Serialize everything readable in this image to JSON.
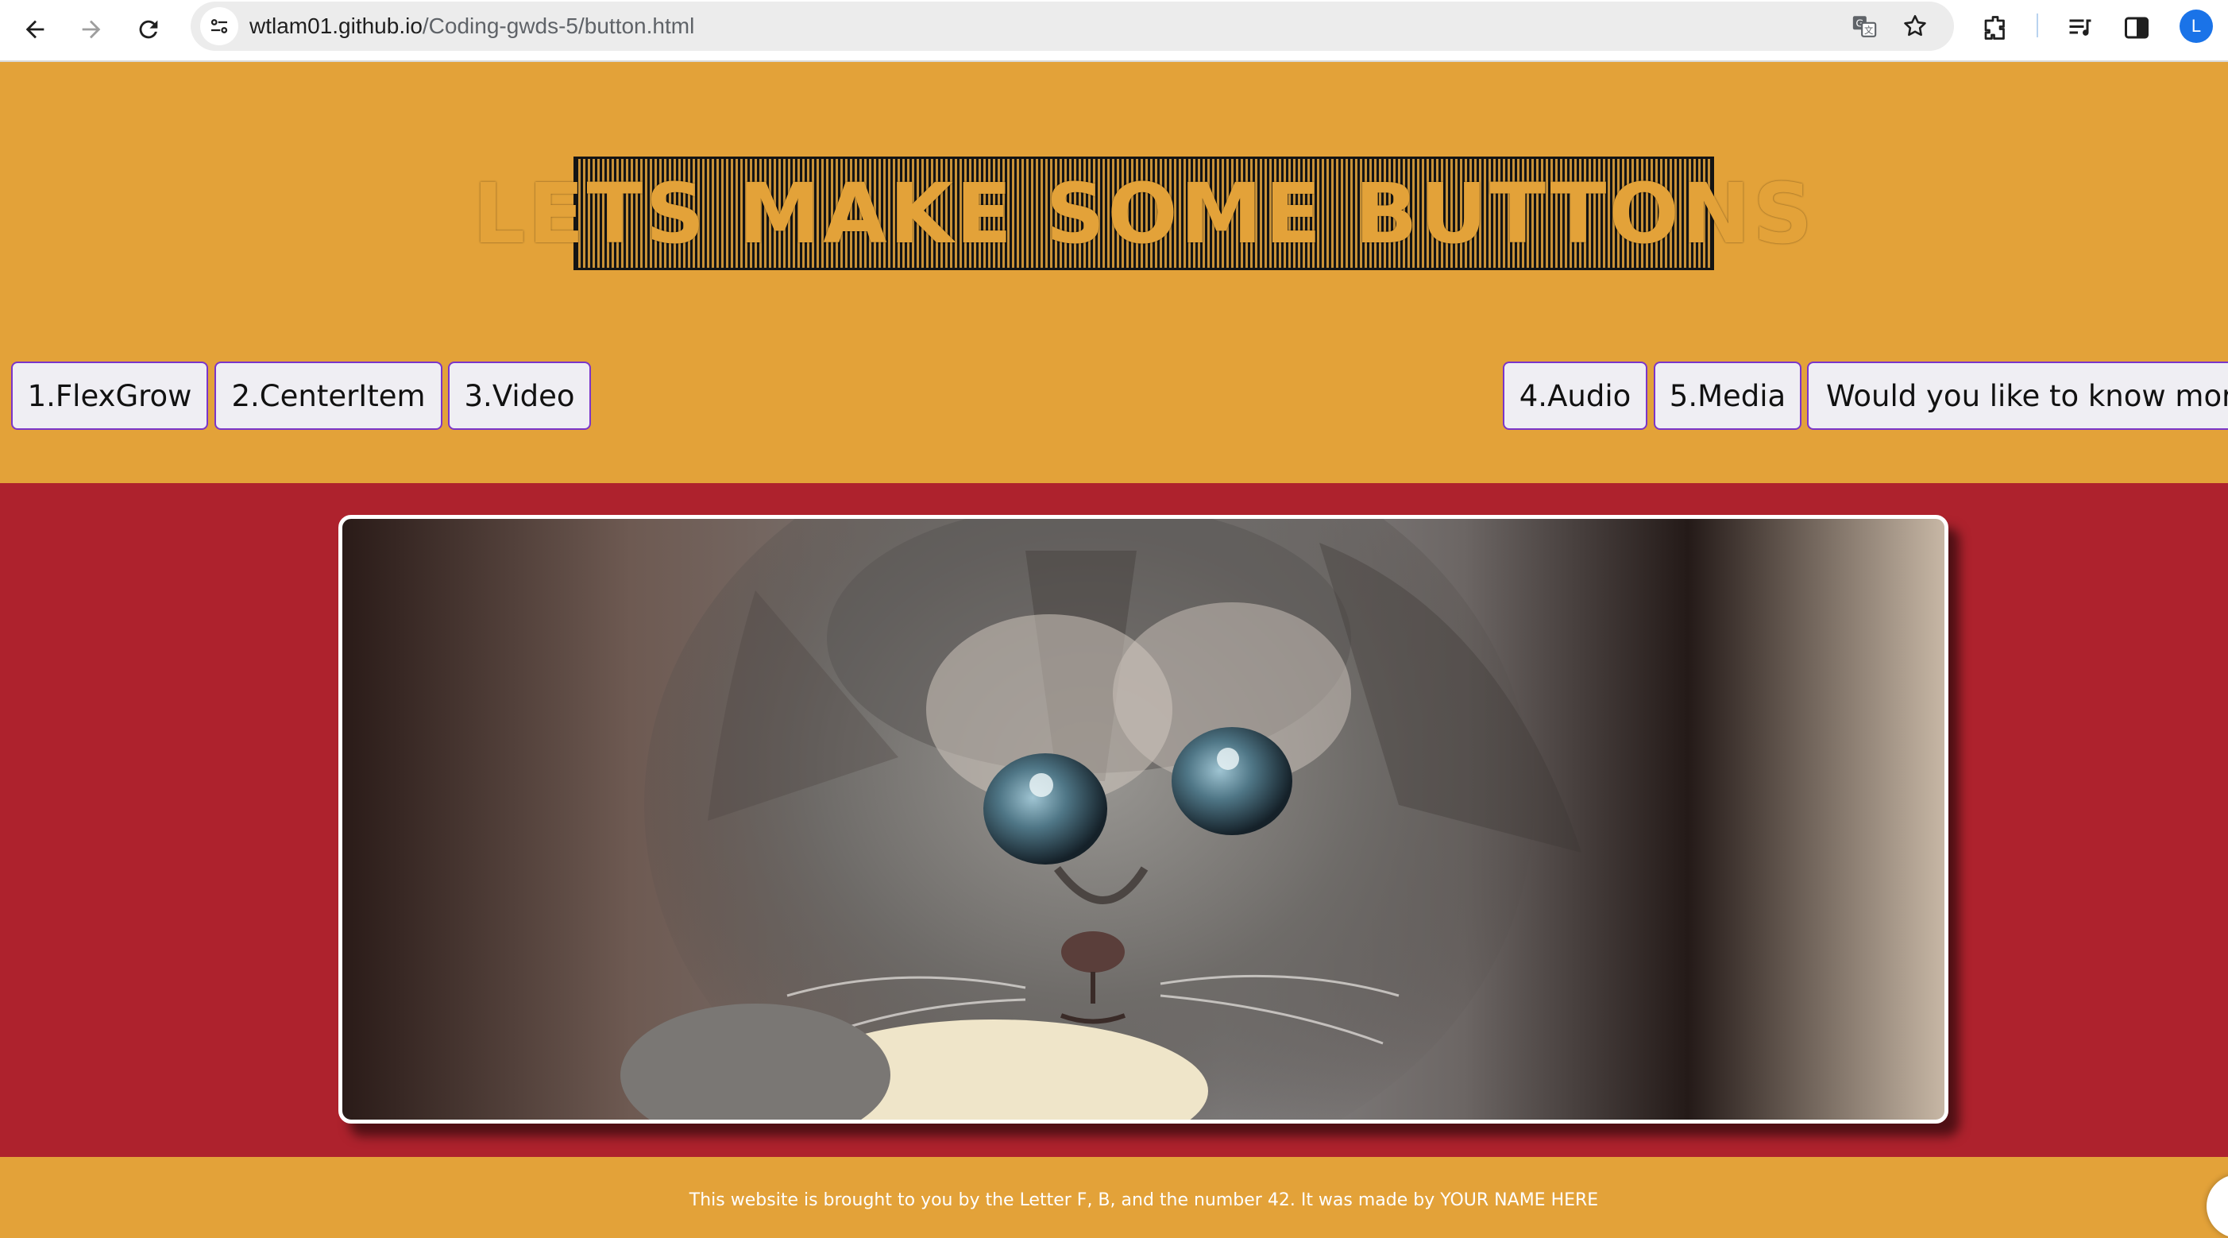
{
  "browser": {
    "url_host": "wtlam01.github.io",
    "url_path": "/Coding-gwds-5/button.html",
    "profile_initial": "L",
    "icons": [
      "back-arrow-icon",
      "forward-arrow-icon",
      "reload-icon",
      "site-settings-icon",
      "translate-icon",
      "bookmark-star-icon",
      "extensions-icon",
      "media-controls-icon",
      "side-panel-icon"
    ]
  },
  "header": {
    "title": "LETS MAKE SOME BUTTONS"
  },
  "nav": {
    "buttons": [
      {
        "label": "1.FlexGrow"
      },
      {
        "label": "2.CenterItem"
      },
      {
        "label": "3.Video"
      },
      {
        "label": "4.Audio"
      },
      {
        "label": "5.Media"
      },
      {
        "label": "Would you like to know more?"
      }
    ]
  },
  "hero": {
    "image": "kitten-photo"
  },
  "footer": {
    "text": "This website is brought to you by the Letter F, B, and the number 42. It was made by YOUR NAME HERE"
  },
  "colors": {
    "page_orange": "#e3a239",
    "band_red": "#ae222d",
    "button_border": "#7b35c9",
    "button_bg": "#efeef3"
  }
}
